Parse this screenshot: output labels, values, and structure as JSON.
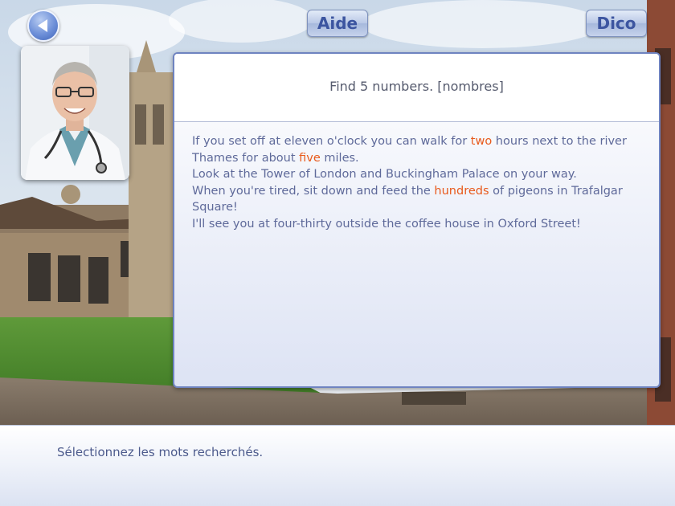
{
  "toolbar": {
    "back_icon": "left-arrow-icon",
    "aide_label": "Aide",
    "dico_label": "Dico"
  },
  "avatar": {
    "icon": "doctor-avatar"
  },
  "exercise": {
    "instruction": "Find 5 numbers. [nombres]",
    "paragraphs": [
      [
        {
          "t": "If you set off at eleven o'clock you can walk for ",
          "hl": false
        },
        {
          "t": "two",
          "hl": true
        },
        {
          "t": " hours next to the river Thames for about ",
          "hl": false
        },
        {
          "t": "five",
          "hl": true
        },
        {
          "t": " miles.",
          "hl": false
        }
      ],
      [
        {
          "t": "Look at the Tower of London and Buckingham Palace on your way.",
          "hl": false
        }
      ],
      [
        {
          "t": "When you're tired, sit down and feed the ",
          "hl": false
        },
        {
          "t": "hundreds",
          "hl": true
        },
        {
          "t": " of pigeons in Trafalgar Square!",
          "hl": false
        }
      ],
      [
        {
          "t": "I'll see you at four-thirty outside the coffee house in Oxford Street!",
          "hl": false
        }
      ]
    ],
    "highlight_color": "#e85a1c",
    "text_color": "#5f6a9a"
  },
  "footer": {
    "status": "Sélectionnez les mots recherchés."
  }
}
